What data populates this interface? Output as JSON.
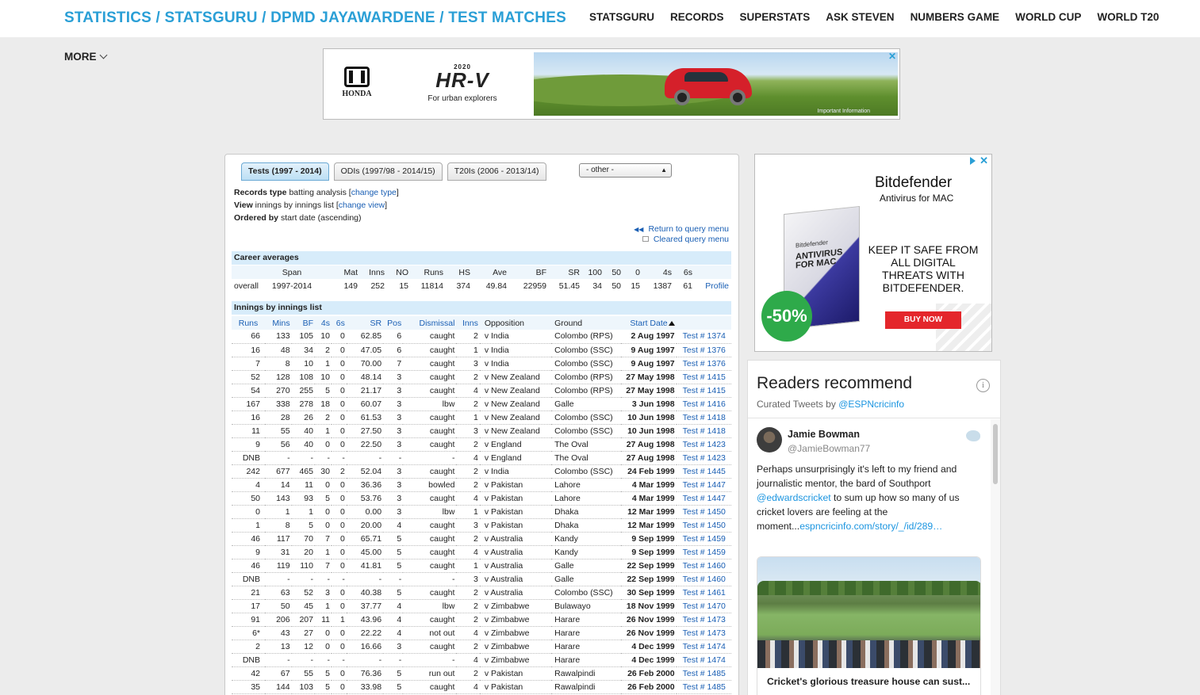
{
  "header": {
    "breadcrumb": "STATISTICS / STATSGURU / DPMD JAYAWARDENE / TEST MATCHES",
    "nav": [
      "STATSGURU",
      "RECORDS",
      "SUPERSTATS",
      "ASK STEVEN",
      "NUMBERS GAME",
      "WORLD CUP",
      "WORLD T20"
    ],
    "more": "MORE"
  },
  "top_ad": {
    "brand": "HONDA",
    "year": "2020",
    "model": "HR-V",
    "tagline": "For urban explorers",
    "info": "Important Information",
    "close": "✕"
  },
  "stats": {
    "tabs": [
      "Tests (1997 - 2014)",
      "ODIs (1997/98 - 2014/15)",
      "T20Is (2006 - 2013/14)"
    ],
    "other_select": "- other -",
    "records_type_label": "Records type",
    "records_type_value": "batting analysis",
    "view_label": "View",
    "view_value": "innings by innings list",
    "change_type": "change type",
    "change_view": "change view",
    "ordered_label": "Ordered by",
    "ordered_value": "start date (ascending)",
    "return_link": "Return to query menu",
    "cleared_link": "Cleared query menu",
    "career_title": "Career averages",
    "career_headers": [
      "",
      "Span",
      "Mat",
      "Inns",
      "NO",
      "Runs",
      "HS",
      "Ave",
      "BF",
      "SR",
      "100",
      "50",
      "0",
      "4s",
      "6s",
      ""
    ],
    "career_row": [
      "overall",
      "1997-2014",
      "149",
      "252",
      "15",
      "11814",
      "374",
      "49.84",
      "22959",
      "51.45",
      "34",
      "50",
      "15",
      "1387",
      "61",
      "Profile"
    ],
    "innings_title": "Innings by innings list",
    "innings_headers": [
      "Runs",
      "Mins",
      "BF",
      "4s",
      "6s",
      "SR",
      "Pos",
      "Dismissal",
      "Inns",
      "Opposition",
      "Ground",
      "Start Date",
      ""
    ],
    "innings": [
      [
        "66",
        "133",
        "105",
        "10",
        "0",
        "62.85",
        "6",
        "caught",
        "2",
        "v India",
        "Colombo (RPS)",
        "2 Aug 1997",
        "Test # 1374"
      ],
      [
        "16",
        "48",
        "34",
        "2",
        "0",
        "47.05",
        "6",
        "caught",
        "1",
        "v India",
        "Colombo (SSC)",
        "9 Aug 1997",
        "Test # 1376"
      ],
      [
        "7",
        "8",
        "10",
        "1",
        "0",
        "70.00",
        "7",
        "caught",
        "3",
        "v India",
        "Colombo (SSC)",
        "9 Aug 1997",
        "Test # 1376"
      ],
      [
        "52",
        "128",
        "108",
        "10",
        "0",
        "48.14",
        "3",
        "caught",
        "2",
        "v New Zealand",
        "Colombo (RPS)",
        "27 May 1998",
        "Test # 1415"
      ],
      [
        "54",
        "270",
        "255",
        "5",
        "0",
        "21.17",
        "3",
        "caught",
        "4",
        "v New Zealand",
        "Colombo (RPS)",
        "27 May 1998",
        "Test # 1415"
      ],
      [
        "167",
        "338",
        "278",
        "18",
        "0",
        "60.07",
        "3",
        "lbw",
        "2",
        "v New Zealand",
        "Galle",
        "3 Jun 1998",
        "Test # 1416"
      ],
      [
        "16",
        "28",
        "26",
        "2",
        "0",
        "61.53",
        "3",
        "caught",
        "1",
        "v New Zealand",
        "Colombo (SSC)",
        "10 Jun 1998",
        "Test # 1418"
      ],
      [
        "11",
        "55",
        "40",
        "1",
        "0",
        "27.50",
        "3",
        "caught",
        "3",
        "v New Zealand",
        "Colombo (SSC)",
        "10 Jun 1998",
        "Test # 1418"
      ],
      [
        "9",
        "56",
        "40",
        "0",
        "0",
        "22.50",
        "3",
        "caught",
        "2",
        "v England",
        "The Oval",
        "27 Aug 1998",
        "Test # 1423"
      ],
      [
        "DNB",
        "-",
        "-",
        "-",
        "-",
        "-",
        "-",
        "-",
        "4",
        "v England",
        "The Oval",
        "27 Aug 1998",
        "Test # 1423"
      ],
      [
        "242",
        "677",
        "465",
        "30",
        "2",
        "52.04",
        "3",
        "caught",
        "2",
        "v India",
        "Colombo (SSC)",
        "24 Feb 1999",
        "Test # 1445"
      ],
      [
        "4",
        "14",
        "11",
        "0",
        "0",
        "36.36",
        "3",
        "bowled",
        "2",
        "v Pakistan",
        "Lahore",
        "4 Mar 1999",
        "Test # 1447"
      ],
      [
        "50",
        "143",
        "93",
        "5",
        "0",
        "53.76",
        "3",
        "caught",
        "4",
        "v Pakistan",
        "Lahore",
        "4 Mar 1999",
        "Test # 1447"
      ],
      [
        "0",
        "1",
        "1",
        "0",
        "0",
        "0.00",
        "3",
        "lbw",
        "1",
        "v Pakistan",
        "Dhaka",
        "12 Mar 1999",
        "Test # 1450"
      ],
      [
        "1",
        "8",
        "5",
        "0",
        "0",
        "20.00",
        "4",
        "caught",
        "3",
        "v Pakistan",
        "Dhaka",
        "12 Mar 1999",
        "Test # 1450"
      ],
      [
        "46",
        "117",
        "70",
        "7",
        "0",
        "65.71",
        "5",
        "caught",
        "2",
        "v Australia",
        "Kandy",
        "9 Sep 1999",
        "Test # 1459"
      ],
      [
        "9",
        "31",
        "20",
        "1",
        "0",
        "45.00",
        "5",
        "caught",
        "4",
        "v Australia",
        "Kandy",
        "9 Sep 1999",
        "Test # 1459"
      ],
      [
        "46",
        "119",
        "110",
        "7",
        "0",
        "41.81",
        "5",
        "caught",
        "1",
        "v Australia",
        "Galle",
        "22 Sep 1999",
        "Test # 1460"
      ],
      [
        "DNB",
        "-",
        "-",
        "-",
        "-",
        "-",
        "-",
        "-",
        "3",
        "v Australia",
        "Galle",
        "22 Sep 1999",
        "Test # 1460"
      ],
      [
        "21",
        "63",
        "52",
        "3",
        "0",
        "40.38",
        "5",
        "caught",
        "2",
        "v Australia",
        "Colombo (SSC)",
        "30 Sep 1999",
        "Test # 1461"
      ],
      [
        "17",
        "50",
        "45",
        "1",
        "0",
        "37.77",
        "4",
        "lbw",
        "2",
        "v Zimbabwe",
        "Bulawayo",
        "18 Nov 1999",
        "Test # 1470"
      ],
      [
        "91",
        "206",
        "207",
        "11",
        "1",
        "43.96",
        "4",
        "caught",
        "2",
        "v Zimbabwe",
        "Harare",
        "26 Nov 1999",
        "Test # 1473"
      ],
      [
        "6*",
        "43",
        "27",
        "0",
        "0",
        "22.22",
        "4",
        "not out",
        "4",
        "v Zimbabwe",
        "Harare",
        "26 Nov 1999",
        "Test # 1473"
      ],
      [
        "2",
        "13",
        "12",
        "0",
        "0",
        "16.66",
        "3",
        "caught",
        "2",
        "v Zimbabwe",
        "Harare",
        "4 Dec 1999",
        "Test # 1474"
      ],
      [
        "DNB",
        "-",
        "-",
        "-",
        "-",
        "-",
        "-",
        "-",
        "4",
        "v Zimbabwe",
        "Harare",
        "4 Dec 1999",
        "Test # 1474"
      ],
      [
        "42",
        "67",
        "55",
        "5",
        "0",
        "76.36",
        "5",
        "run out",
        "2",
        "v Pakistan",
        "Rawalpindi",
        "26 Feb 2000",
        "Test # 1485"
      ],
      [
        "35",
        "144",
        "103",
        "5",
        "0",
        "33.98",
        "5",
        "caught",
        "4",
        "v Pakistan",
        "Rawalpindi",
        "26 Feb 2000",
        "Test # 1485"
      ]
    ]
  },
  "right_ad": {
    "brand": "Bitdefender",
    "product": "Antivirus for MAC",
    "box_brand": "Bitdefender",
    "box_product": "ANTIVIRUS FOR MAC",
    "message": "KEEP IT SAFE FROM ALL DIGITAL THREATS WITH BITDEFENDER.",
    "button": "BUY NOW",
    "discount": "-50%",
    "close": "✕"
  },
  "twitter": {
    "title": "Readers recommend",
    "curated_prefix": "Curated Tweets by",
    "curated_handle": "@ESPNcricinfo",
    "info": "i",
    "tweet": {
      "name": "Jamie Bowman",
      "handle": "@JamieBowman77",
      "text_1": "Perhaps unsurprisingly it's left to my friend and journalistic mentor, the bard of Southport ",
      "mention": "@edwardscricket",
      "text_2": " to sum up how so many of us cricket lovers are feeling at the moment...",
      "link": "espncricinfo.com/story/_/id/289…",
      "card_title": "Cricket's glorious treasure house can sust..."
    }
  }
}
